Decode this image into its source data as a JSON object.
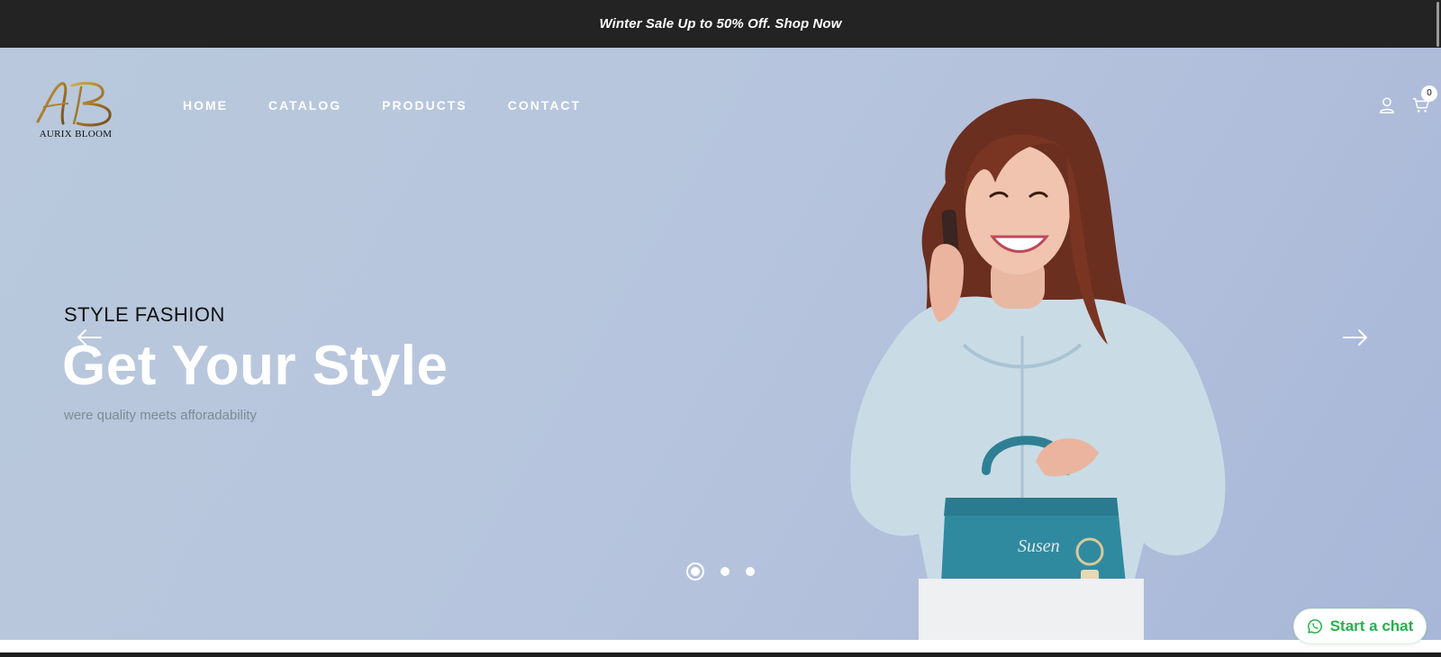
{
  "announcement": {
    "text": "Winter Sale Up to 50% Off. Shop Now"
  },
  "header": {
    "logo_monogram": "AB",
    "brand_name": "AURIX BLOOM",
    "nav": [
      {
        "label": "HOME"
      },
      {
        "label": "CATALOG"
      },
      {
        "label": "PRODUCTS"
      },
      {
        "label": "CONTACT"
      }
    ],
    "cart_count": "0",
    "icons": [
      "user-icon",
      "cart-icon"
    ]
  },
  "hero": {
    "eyebrow": "STYLE FASHION",
    "headline": "Get Your Style",
    "subline": "were quality meets afforadability",
    "bag_brand": "Susen",
    "slides_total": 3,
    "active_slide": 1,
    "icons": [
      "arrow-left-icon",
      "arrow-right-icon"
    ]
  },
  "chat": {
    "label": "Start a chat",
    "icon": "whatsapp-icon",
    "accent": "#25b14c"
  },
  "colors": {
    "announcement_bg": "#232323",
    "hero_bg": "#b7c6dd",
    "nav_text": "#ffffff",
    "logo_gold": "#b08a3e"
  }
}
